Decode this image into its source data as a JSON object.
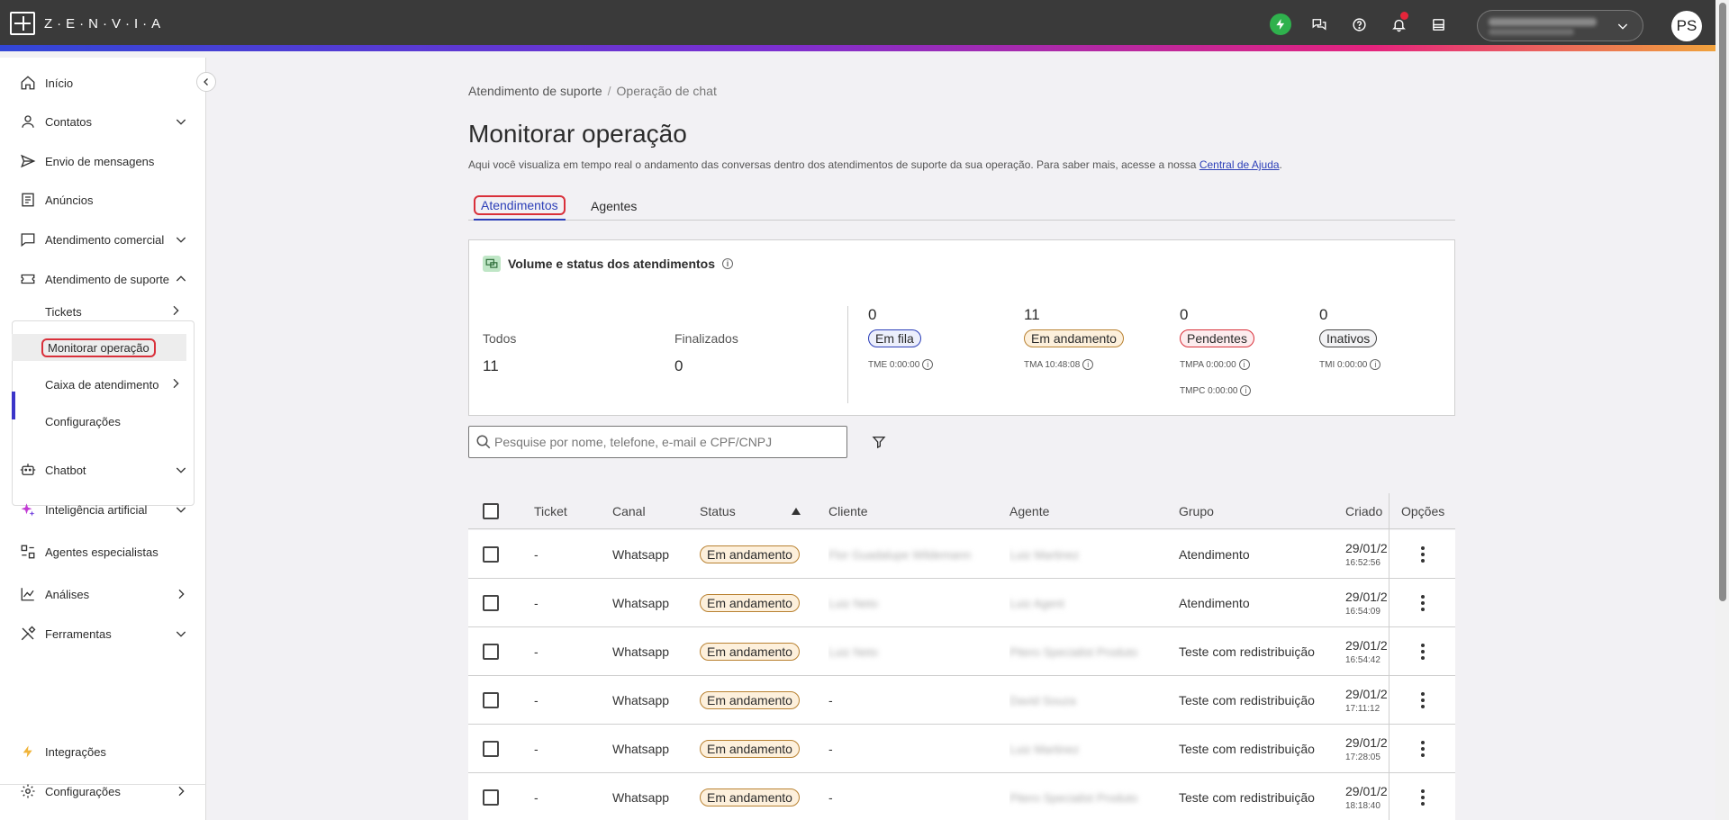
{
  "topbar": {
    "brand": "Z·E·N·V·I·A",
    "avatar_initials": "PS",
    "icons": [
      "lightning-icon",
      "chat-icon",
      "help-icon",
      "bell-icon",
      "inbox-icon"
    ],
    "colors": {
      "bar": "#3a3a3a",
      "lightning_bg": "#2fb14d",
      "notification_dot": "#e5253a"
    }
  },
  "sidebar": {
    "items": [
      {
        "label": "Início",
        "icon": "home-icon"
      },
      {
        "label": "Contatos",
        "icon": "person-icon"
      },
      {
        "label": "Envio de mensagens",
        "icon": "send-icon"
      },
      {
        "label": "Anúncios",
        "icon": "newspaper-icon"
      },
      {
        "label": "Atendimento comercial",
        "icon": "chat-bubble-icon"
      },
      {
        "label": "Atendimento de suporte",
        "icon": "ticket-icon"
      },
      {
        "label": "Chatbot",
        "icon": "robot-icon"
      },
      {
        "label": "Inteligência artificial",
        "icon": "sparkle-icon"
      },
      {
        "label": "Agentes especialistas",
        "icon": "agents-icon"
      },
      {
        "label": "Análises",
        "icon": "chart-icon"
      },
      {
        "label": "Ferramentas",
        "icon": "tools-icon"
      },
      {
        "label": "Integrações",
        "icon": "lightning-icon"
      },
      {
        "label": "Configurações",
        "icon": "gear-icon"
      }
    ],
    "support_sub": [
      {
        "label": "Tickets"
      },
      {
        "label": "Monitorar operação"
      },
      {
        "label": "Caixa de atendimento"
      },
      {
        "label": "Configurações"
      }
    ]
  },
  "breadcrumb": {
    "parent": "Atendimento de suporte",
    "separator": "/",
    "current": "Operação de chat"
  },
  "page": {
    "title": "Monitorar operação",
    "description": "Aqui você visualiza em tempo real o andamento das conversas dentro dos atendimentos de suporte da sua operação. Para saber mais, acesse a nossa ",
    "help_link": "Central de Ajuda",
    "description_end": "."
  },
  "tabs": [
    {
      "label": "Atendimentos"
    },
    {
      "label": "Agentes"
    }
  ],
  "stats": {
    "title": "Volume e status dos atendimentos",
    "todos_label": "Todos",
    "todos_value": "11",
    "finalizados_label": "Finalizados",
    "finalizados_value": "0",
    "em_fila": {
      "count": "0",
      "label": "Em fila",
      "metric": "TME 0:00:00"
    },
    "em_andamento": {
      "count": "11",
      "label": "Em andamento",
      "metric": "TMA 10:48:08"
    },
    "pendentes": {
      "count": "0",
      "label": "Pendentes",
      "metric": "TMPA 0:00:00",
      "metric2": "TMPC 0:00:00"
    },
    "inativos": {
      "count": "0",
      "label": "Inativos",
      "metric": "TMI 0:00:00"
    }
  },
  "search": {
    "placeholder": "Pesquise por nome, telefone, e-mail e CPF/CNPJ"
  },
  "table": {
    "headers": [
      "Ticket",
      "Canal",
      "Status",
      "Cliente",
      "Agente",
      "Grupo",
      "Criado",
      "Opções"
    ],
    "rows": [
      {
        "ticket": "-",
        "canal": "Whatsapp",
        "status": "Em andamento",
        "cliente": "Flor Guadalupe Wildemann",
        "agente": "Luiz Martinez",
        "grupo": "Atendimento",
        "date": "29/01/2",
        "time": "16:52:56"
      },
      {
        "ticket": "-",
        "canal": "Whatsapp",
        "status": "Em andamento",
        "cliente": "Luiz Neto",
        "agente": "Luiz Agent",
        "grupo": "Atendimento",
        "date": "29/01/2",
        "time": "16:54:09"
      },
      {
        "ticket": "-",
        "canal": "Whatsapp",
        "status": "Em andamento",
        "cliente": "Luiz Neto",
        "agente": "Pitero Specialist Produto",
        "grupo": "Teste com redistribuição",
        "date": "29/01/2",
        "time": "16:54:42"
      },
      {
        "ticket": "-",
        "canal": "Whatsapp",
        "status": "Em andamento",
        "cliente": "-",
        "agente": "David Souza",
        "grupo": "Teste com redistribuição",
        "date": "29/01/2",
        "time": "17:11:12"
      },
      {
        "ticket": "-",
        "canal": "Whatsapp",
        "status": "Em andamento",
        "cliente": "-",
        "agente": "Luiz Martinez",
        "grupo": "Teste com redistribuição",
        "date": "29/01/2",
        "time": "17:28:05"
      },
      {
        "ticket": "-",
        "canal": "Whatsapp",
        "status": "Em andamento",
        "cliente": "-",
        "agente": "Pitero Specialist Produto",
        "grupo": "Teste com redistribuição",
        "date": "29/01/2",
        "time": "18:18:40"
      }
    ]
  }
}
